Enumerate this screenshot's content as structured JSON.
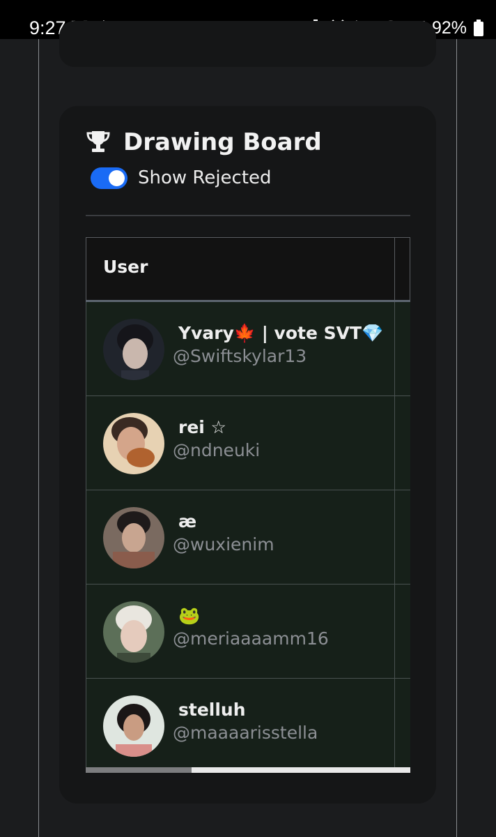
{
  "status_bar": {
    "time": "9:27",
    "battery_percent": "92%",
    "left_icons": [
      "screen-record-icon",
      "repost-icon",
      "heart-icon"
    ],
    "right_icons": [
      "battery-saver-icon",
      "alarm-icon",
      "mute-icon",
      "wifi-icon",
      "signal-icon",
      "battery-icon"
    ]
  },
  "section": {
    "icon": "trophy-icon",
    "title": "Drawing Board",
    "toggle": {
      "label": "Show Rejected",
      "on": true,
      "color": "#1a6bf5"
    }
  },
  "table": {
    "columns": [
      "User"
    ],
    "rows": [
      {
        "name": "Yvary🍁 | vote SVT💎",
        "handle": "@Swiftskylar13"
      },
      {
        "name": "rei ☆",
        "handle": "@ndneuki"
      },
      {
        "name": "æ",
        "handle": "@wuxienim"
      },
      {
        "name": "🐸",
        "handle": "@meriaaaamm16"
      },
      {
        "name": "stelluh",
        "handle": "@maaaarisstella"
      }
    ],
    "horizontal_scroll_position": 0
  },
  "colors": {
    "background": "#1b1c1e",
    "card": "#151617",
    "row_background": "#162019",
    "accent": "#1a6bf5"
  }
}
